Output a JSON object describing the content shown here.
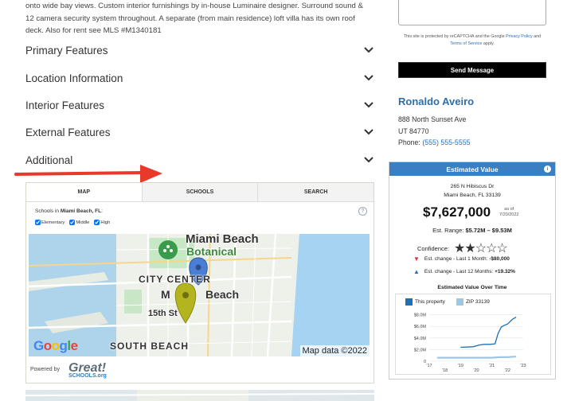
{
  "description": {
    "lines": [
      "onto wide bay views. Custom interior furnishings by in-house Luminaire designer. Surround sound &",
      "12 camera security system throughout. A separate (from main residence) loft villa has its own roof",
      "deck. Also for rent see MLS #M1340181"
    ]
  },
  "accordion": [
    {
      "label": "Primary Features"
    },
    {
      "label": "Location Information"
    },
    {
      "label": "Interior Features"
    },
    {
      "label": "External Features"
    },
    {
      "label": "Additional"
    }
  ],
  "colors": {
    "accent": "#2f6ea8",
    "arrow": "#e8392b",
    "header": "#3b7fc3"
  },
  "schools": {
    "tabs": [
      "MAP",
      "SCHOOLS",
      "SEARCH"
    ],
    "active_tab": "MAP",
    "in_prefix": "Schools in",
    "city": "Miami Beach, FL",
    "in_suffix": ":",
    "help": "?",
    "filters": [
      {
        "label": "Elementary",
        "checked": true
      },
      {
        "label": "Middle",
        "checked": true
      },
      {
        "label": "High",
        "checked": true
      }
    ],
    "map_labels": {
      "miami_beach": "Miami Beach",
      "botanical": "Botanical",
      "city_center": "CITY CENTER",
      "m_beach_left": "M",
      "m_beach_right": "Beach",
      "street_15": "15th St",
      "south_beach": "SOUTH BEACH",
      "map_data": "Map data ©2022",
      "google": "Google"
    },
    "powered_by": "Powered by",
    "logo_main": "Great!",
    "logo_sub": "SCHOOLS.org"
  },
  "contact": {
    "captcha_text_1": "This site is protected by reCAPTCHA and the Google",
    "privacy_link": "Privacy Policy",
    "and": "and",
    "terms_link": "Terms of Service",
    "apply": "apply.",
    "send_button": "Send Message",
    "agent_name": "Ronaldo Aveiro",
    "address_1": "888 North Sunset Ave",
    "address_2": "UT 84770",
    "phone_label": "Phone:",
    "phone": "(555) 555-5555"
  },
  "estimate": {
    "header": "Estimated Value",
    "info": "i",
    "street": "265 N Hibiscus Dr",
    "city": "Miami Beach, FL 33139",
    "price": "$7,627,000",
    "as_of_label": "as of",
    "as_of_date": "7/20/2022",
    "range_label": "Est. Range:",
    "range_value": "$5.72M – $9.53M",
    "confidence_label": "Confidence:",
    "confidence_stars": 2,
    "confidence_max": 5,
    "change_month_label": "Est. change - Last 1 Month:",
    "change_month_value": "-$80,000",
    "change_year_label": "Est. change - Last 12 Months:",
    "change_year_value": "+19.32%",
    "chart_title": "Estimated Value Over Time",
    "legend_property": "This property",
    "legend_zip": "ZIP 33139"
  },
  "chart_data": {
    "type": "line",
    "title": "Estimated Value Over Time",
    "x_ticks": [
      "'17",
      "'18",
      "'19",
      "'20",
      "'21",
      "'22",
      "'23"
    ],
    "y_ticks": [
      "0",
      "$2.0M",
      "$4.0M",
      "$6.0M",
      "$8.0M"
    ],
    "ylim": [
      0,
      8.5
    ],
    "series": [
      {
        "name": "This property",
        "x": [
          2019.0,
          2019.8,
          2020.2,
          2020.5,
          2020.9,
          2021.2,
          2021.4,
          2021.6,
          2021.8,
          2022.0,
          2022.3,
          2022.55
        ],
        "values": [
          2.4,
          2.5,
          2.8,
          2.9,
          2.9,
          3.0,
          4.8,
          5.9,
          6.2,
          6.4,
          7.2,
          7.6
        ]
      },
      {
        "name": "ZIP 33139",
        "x": [
          2017.5,
          2018.0,
          2018.5,
          2019.0,
          2019.5,
          2020.0,
          2020.5,
          2021.0,
          2021.5,
          2022.0,
          2022.55
        ],
        "values": [
          0.6,
          0.6,
          0.6,
          0.6,
          0.6,
          0.6,
          0.6,
          0.6,
          0.7,
          0.7,
          0.8
        ]
      }
    ]
  }
}
